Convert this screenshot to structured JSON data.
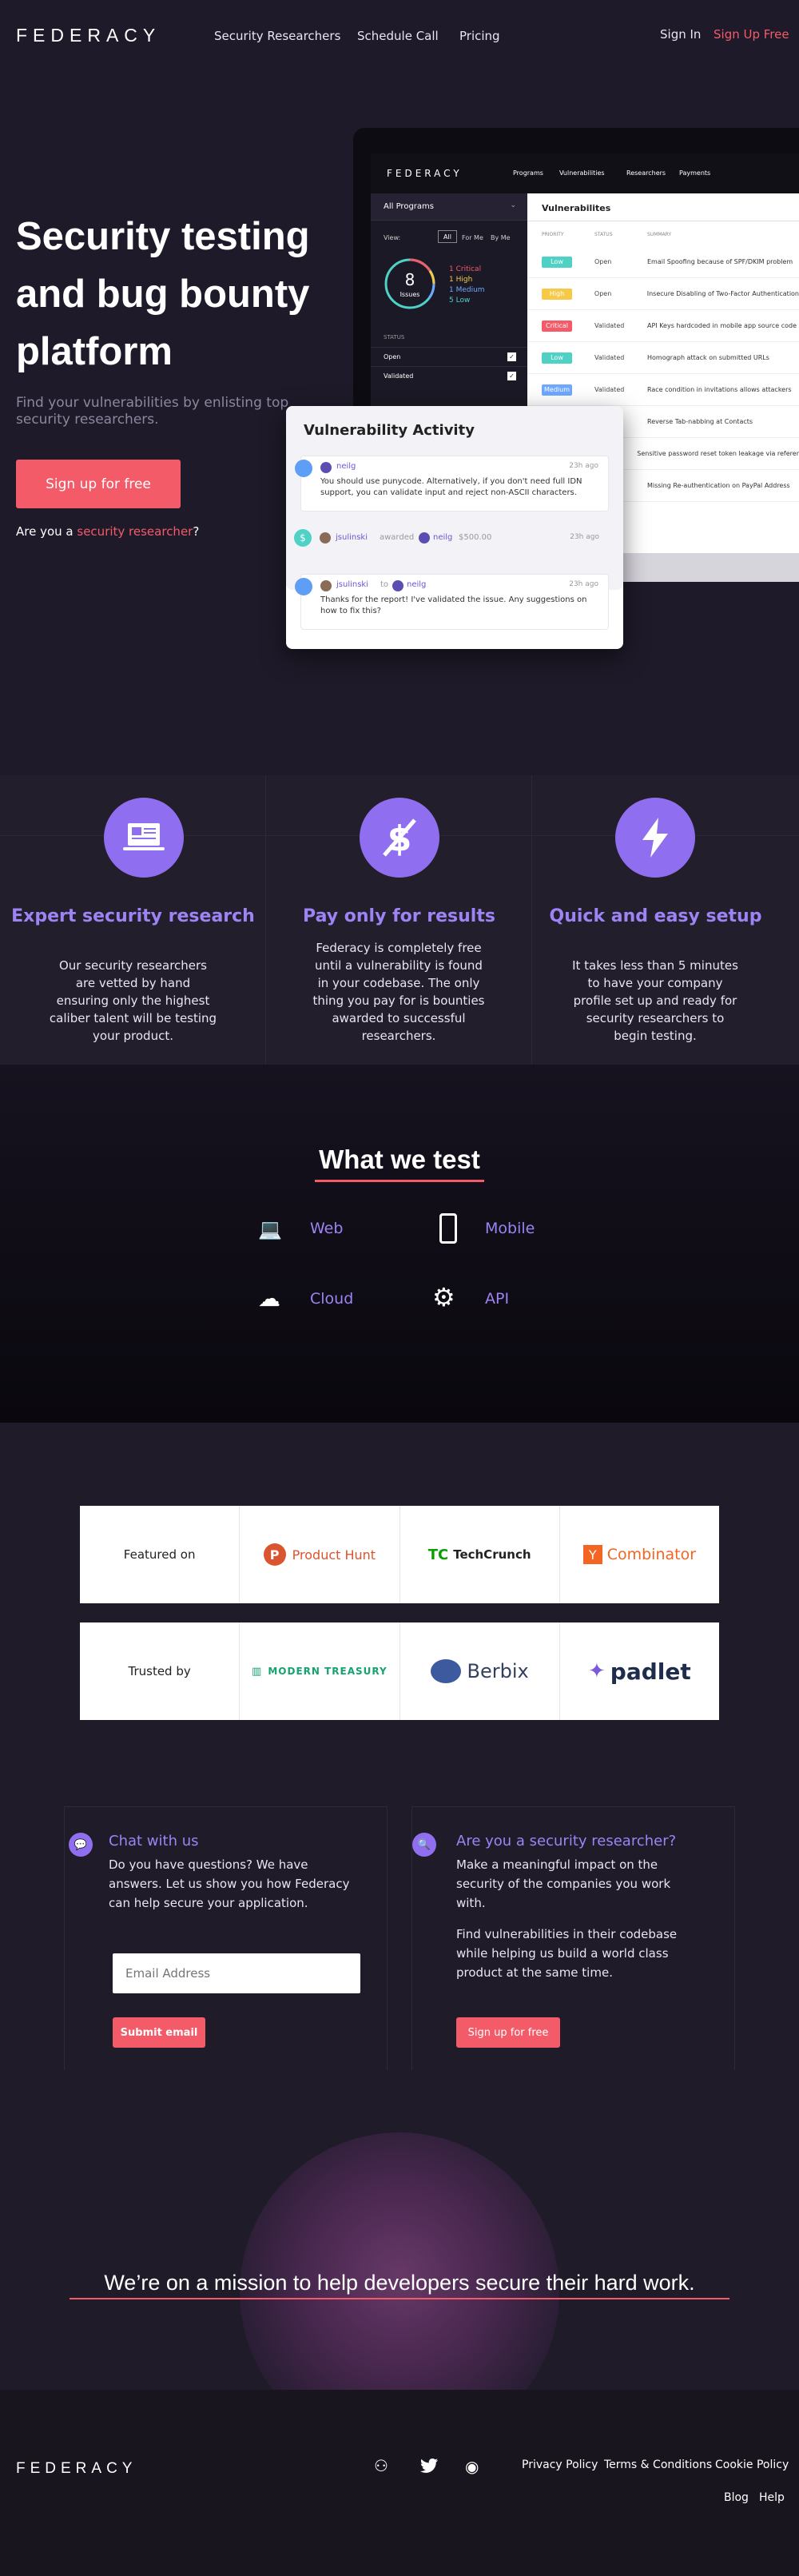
{
  "nav": {
    "brand": "FEDERACY",
    "links": [
      "Security Researchers",
      "Schedule Call",
      "Pricing"
    ],
    "sign_in": "Sign In",
    "sign_up": "Sign Up Free"
  },
  "hero": {
    "title": "Security testing and bug bounty platform",
    "subtitle": "Find your vulnerabilities by enlisting top security researchers.",
    "cta": "Sign up for free",
    "researcher_prefix": "Are you a ",
    "researcher_link": "security researcher",
    "researcher_suffix": "?"
  },
  "app": {
    "brand": "FEDERACY",
    "nav": [
      "Programs",
      "Vulnerabilities",
      "Researchers",
      "Payments"
    ],
    "all_programs": "All Programs",
    "view_label": "View:",
    "view_tabs": [
      "All",
      "For Me",
      "By Me"
    ],
    "issues_count": "8",
    "issues_label": "Issues",
    "severity": [
      {
        "label": "1 Critical",
        "color": "#f45b69"
      },
      {
        "label": "1 High",
        "color": "#f7c948"
      },
      {
        "label": "1 Medium",
        "color": "#6ea8ff"
      },
      {
        "label": "5 Low",
        "color": "#4fd1c5"
      }
    ],
    "status_header": "STATUS",
    "statuses": [
      "Open",
      "Validated"
    ],
    "main_title": "Vulnerabilites",
    "columns": [
      "PRIORITY",
      "STATUS",
      "SUMMARY"
    ],
    "rows": [
      {
        "priority": "Low",
        "color": "#4fd1c5",
        "status": "Open",
        "summary": "Email Spoofing because of SPF/DKIM problem"
      },
      {
        "priority": "High",
        "color": "#f7c948",
        "status": "Open",
        "summary": "Insecure Disabling of Two-Factor Authentication"
      },
      {
        "priority": "Critical",
        "color": "#f45b69",
        "status": "Validated",
        "summary": "API Keys hardcoded in mobile app source code"
      },
      {
        "priority": "Low",
        "color": "#4fd1c5",
        "status": "Validated",
        "summary": "Homograph attack on submitted URLs"
      },
      {
        "priority": "Medium",
        "color": "#6ea8ff",
        "status": "Validated",
        "summary": "Race condition in invitations allows attackers"
      },
      {
        "priority": "",
        "color": "",
        "status": "",
        "summary": "Reverse Tab-nabbing at Contacts"
      },
      {
        "priority": "",
        "color": "",
        "status": "",
        "summary": "Sensitive password reset token leakage via referer"
      },
      {
        "priority": "",
        "color": "",
        "status": "",
        "summary": "Missing Re-authentication on PayPal Address"
      }
    ]
  },
  "activity": {
    "title": "Vulnerability Activity",
    "items": [
      {
        "user": "neilg",
        "time": "23h ago",
        "text": "You should use punycode. Alternatively, if you don't need full IDN support, you can validate input and reject non-ASCII characters."
      },
      {
        "user": "jsulinski",
        "verb": "awarded",
        "target": "neilg",
        "amount": "$500.00",
        "time": "23h ago"
      },
      {
        "user": "jsulinski",
        "verb": "to",
        "target": "neilg",
        "time": "23h ago",
        "text": "Thanks for the report! I've validated the issue. Any suggestions on how to fix this?"
      }
    ]
  },
  "features": [
    {
      "icon": "laptop-icon",
      "title": "Expert security research",
      "text": "Our security researchers are vetted by hand ensuring only the highest caliber talent will be testing your product."
    },
    {
      "icon": "no-dollar-icon",
      "title": "Pay only for results",
      "text": "Federacy is completely free until a vulnerability is found in your codebase. The only thing you pay for is bounties awarded to successful researchers."
    },
    {
      "icon": "lightning-icon",
      "title": "Quick and easy setup",
      "text": "It takes less than 5 minutes to have your company profile set up and ready for security researchers to begin testing."
    }
  ],
  "what_we_test": {
    "title": "What we test",
    "items": [
      "Web",
      "Mobile",
      "Cloud",
      "API"
    ]
  },
  "featured": {
    "label": "Featured on",
    "items": [
      "Product Hunt",
      "TechCrunch",
      "Combinator"
    ]
  },
  "trusted": {
    "label": "Trusted by",
    "items": [
      "MODERN TREASURY",
      "Berbix",
      "padlet"
    ]
  },
  "chat": {
    "title": "Chat with us",
    "text": "Do you have questions? We have answers. Let us show you how Federacy can help secure your application.",
    "placeholder": "Email Address",
    "button": "Submit email"
  },
  "researcher": {
    "title": "Are you a security researcher?",
    "text1": "Make a meaningful impact on the security of the companies you work with.",
    "text2": "Find vulnerabilities in their codebase while helping us build a world class product at the same time.",
    "button": "Sign up for free"
  },
  "mission": "We’re on a mission to help developers secure their hard work.",
  "footer": {
    "brand": "FEDERACY",
    "links": [
      "Privacy Policy",
      "Terms & Conditions",
      "Cookie Policy",
      "Blog",
      "Help"
    ]
  },
  "colors": {
    "accent": "#f45b69",
    "purple": "#9e83f5",
    "bg": "#1e1a29"
  }
}
